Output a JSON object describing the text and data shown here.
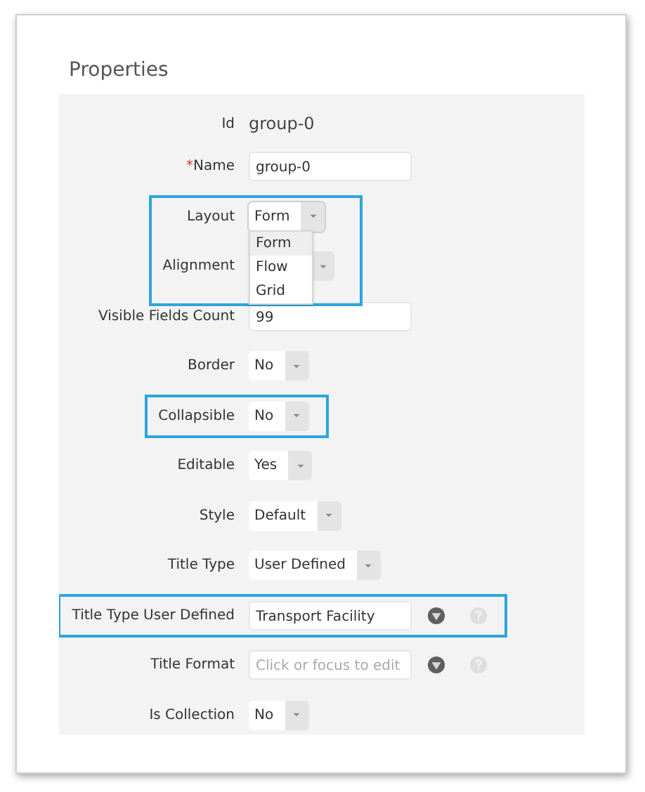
{
  "title": "Properties",
  "rows": [
    {
      "kind": "static",
      "label": "Id",
      "value": "group-0",
      "highlighted": false
    },
    {
      "kind": "input",
      "label": "Name",
      "value": "group-0",
      "mark": "*",
      "highlighted": false
    },
    {
      "kind": "select",
      "label": "Layout",
      "value": "Form",
      "highlighted": true,
      "open": true,
      "options": [
        {
          "label": "Form",
          "selected": true
        },
        {
          "label": "Flow",
          "selected": false
        },
        {
          "label": "Grid",
          "selected": false
        }
      ]
    },
    {
      "kind": "select",
      "label": "Alignment",
      "highlighted": true
    },
    {
      "kind": "input",
      "label": "Visible Fields Count",
      "value": "99",
      "highlighted": false
    },
    {
      "kind": "select",
      "label": "Border",
      "value": "No",
      "highlighted": false
    },
    {
      "kind": "select",
      "label": "Collapsible",
      "value": "No",
      "highlighted": true
    },
    {
      "kind": "select",
      "label": "Editable",
      "value": "Yes",
      "highlighted": false
    },
    {
      "kind": "select",
      "label": "Style",
      "value": "Default",
      "highlighted": false
    },
    {
      "kind": "select",
      "label": "Title Type",
      "value": "User Defined",
      "highlighted": false
    },
    {
      "kind": "input",
      "label": "Title Type User Defined",
      "value": "Transport Facility",
      "highlighted": true,
      "tools": true
    },
    {
      "kind": "input",
      "label": "Title Format",
      "placeholder": "Click or focus to edit",
      "highlighted": false,
      "tools": true
    },
    {
      "kind": "select",
      "label": "Is Collection",
      "value": "No",
      "highlighted": false
    }
  ]
}
